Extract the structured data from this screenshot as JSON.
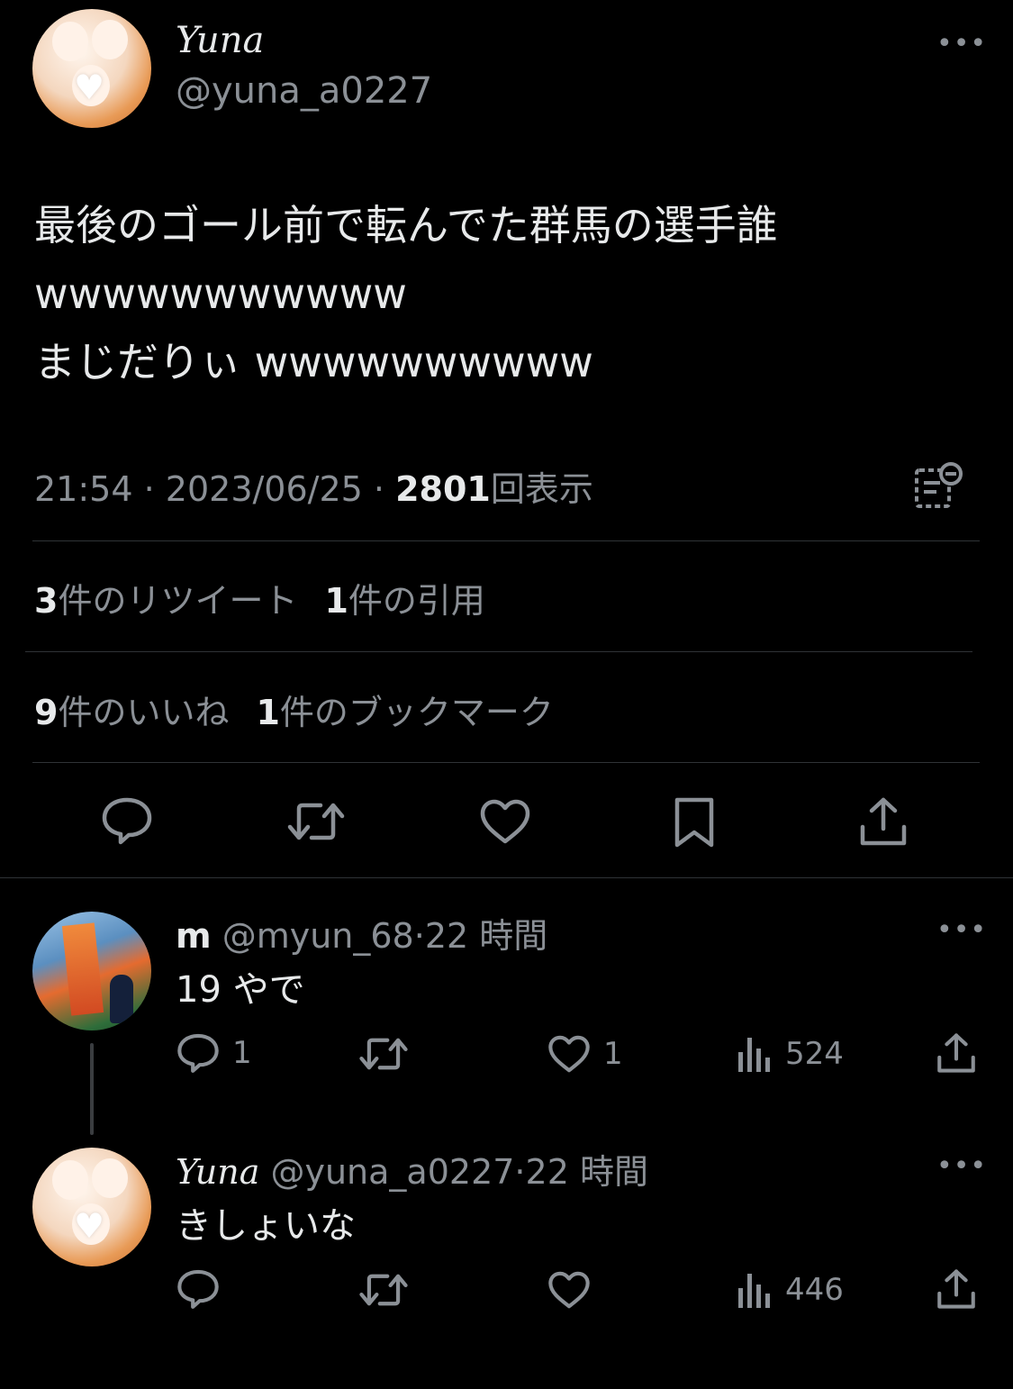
{
  "tweet": {
    "author_name": "Yuna",
    "author_handle": "@yuna_a0227",
    "text_lines": [
      "最後のゴール前で転んでた群馬の選手誰",
      "wwwwwwwwwww",
      "まじだりぃ wwwwwwwwww"
    ],
    "time": "21:54",
    "separator": "·",
    "date": "2023/06/25",
    "views_count": "2801",
    "views_label": "回表示",
    "stats": {
      "retweets_count": "3",
      "retweets_label": "件のリツイート",
      "quotes_count": "1",
      "quotes_label": "件の引用",
      "likes_count": "9",
      "likes_label": "件のいいね",
      "bookmarks_count": "1",
      "bookmarks_label": "件のブックマーク"
    },
    "actions": [
      "reply-icon",
      "retweet-icon",
      "like-icon",
      "bookmark-icon",
      "share-icon"
    ]
  },
  "replies": [
    {
      "name": "m",
      "handle": "@myun_68",
      "separator": "·",
      "time": "22 時間",
      "text": "19 やで",
      "reply_count": "1",
      "retweet_count": "",
      "like_count": "1",
      "views": "524"
    },
    {
      "name": "Yuna",
      "handle": "@yuna_a0227",
      "separator": "·",
      "time": "22 時間",
      "text": "きしょいな",
      "reply_count": "",
      "retweet_count": "",
      "like_count": "",
      "views": "446"
    }
  ],
  "more_glyph": "•••",
  "colors": {
    "background": "#000000",
    "text": "#e7e9ea",
    "secondary": "#8b9096",
    "divider": "#2f3336"
  }
}
